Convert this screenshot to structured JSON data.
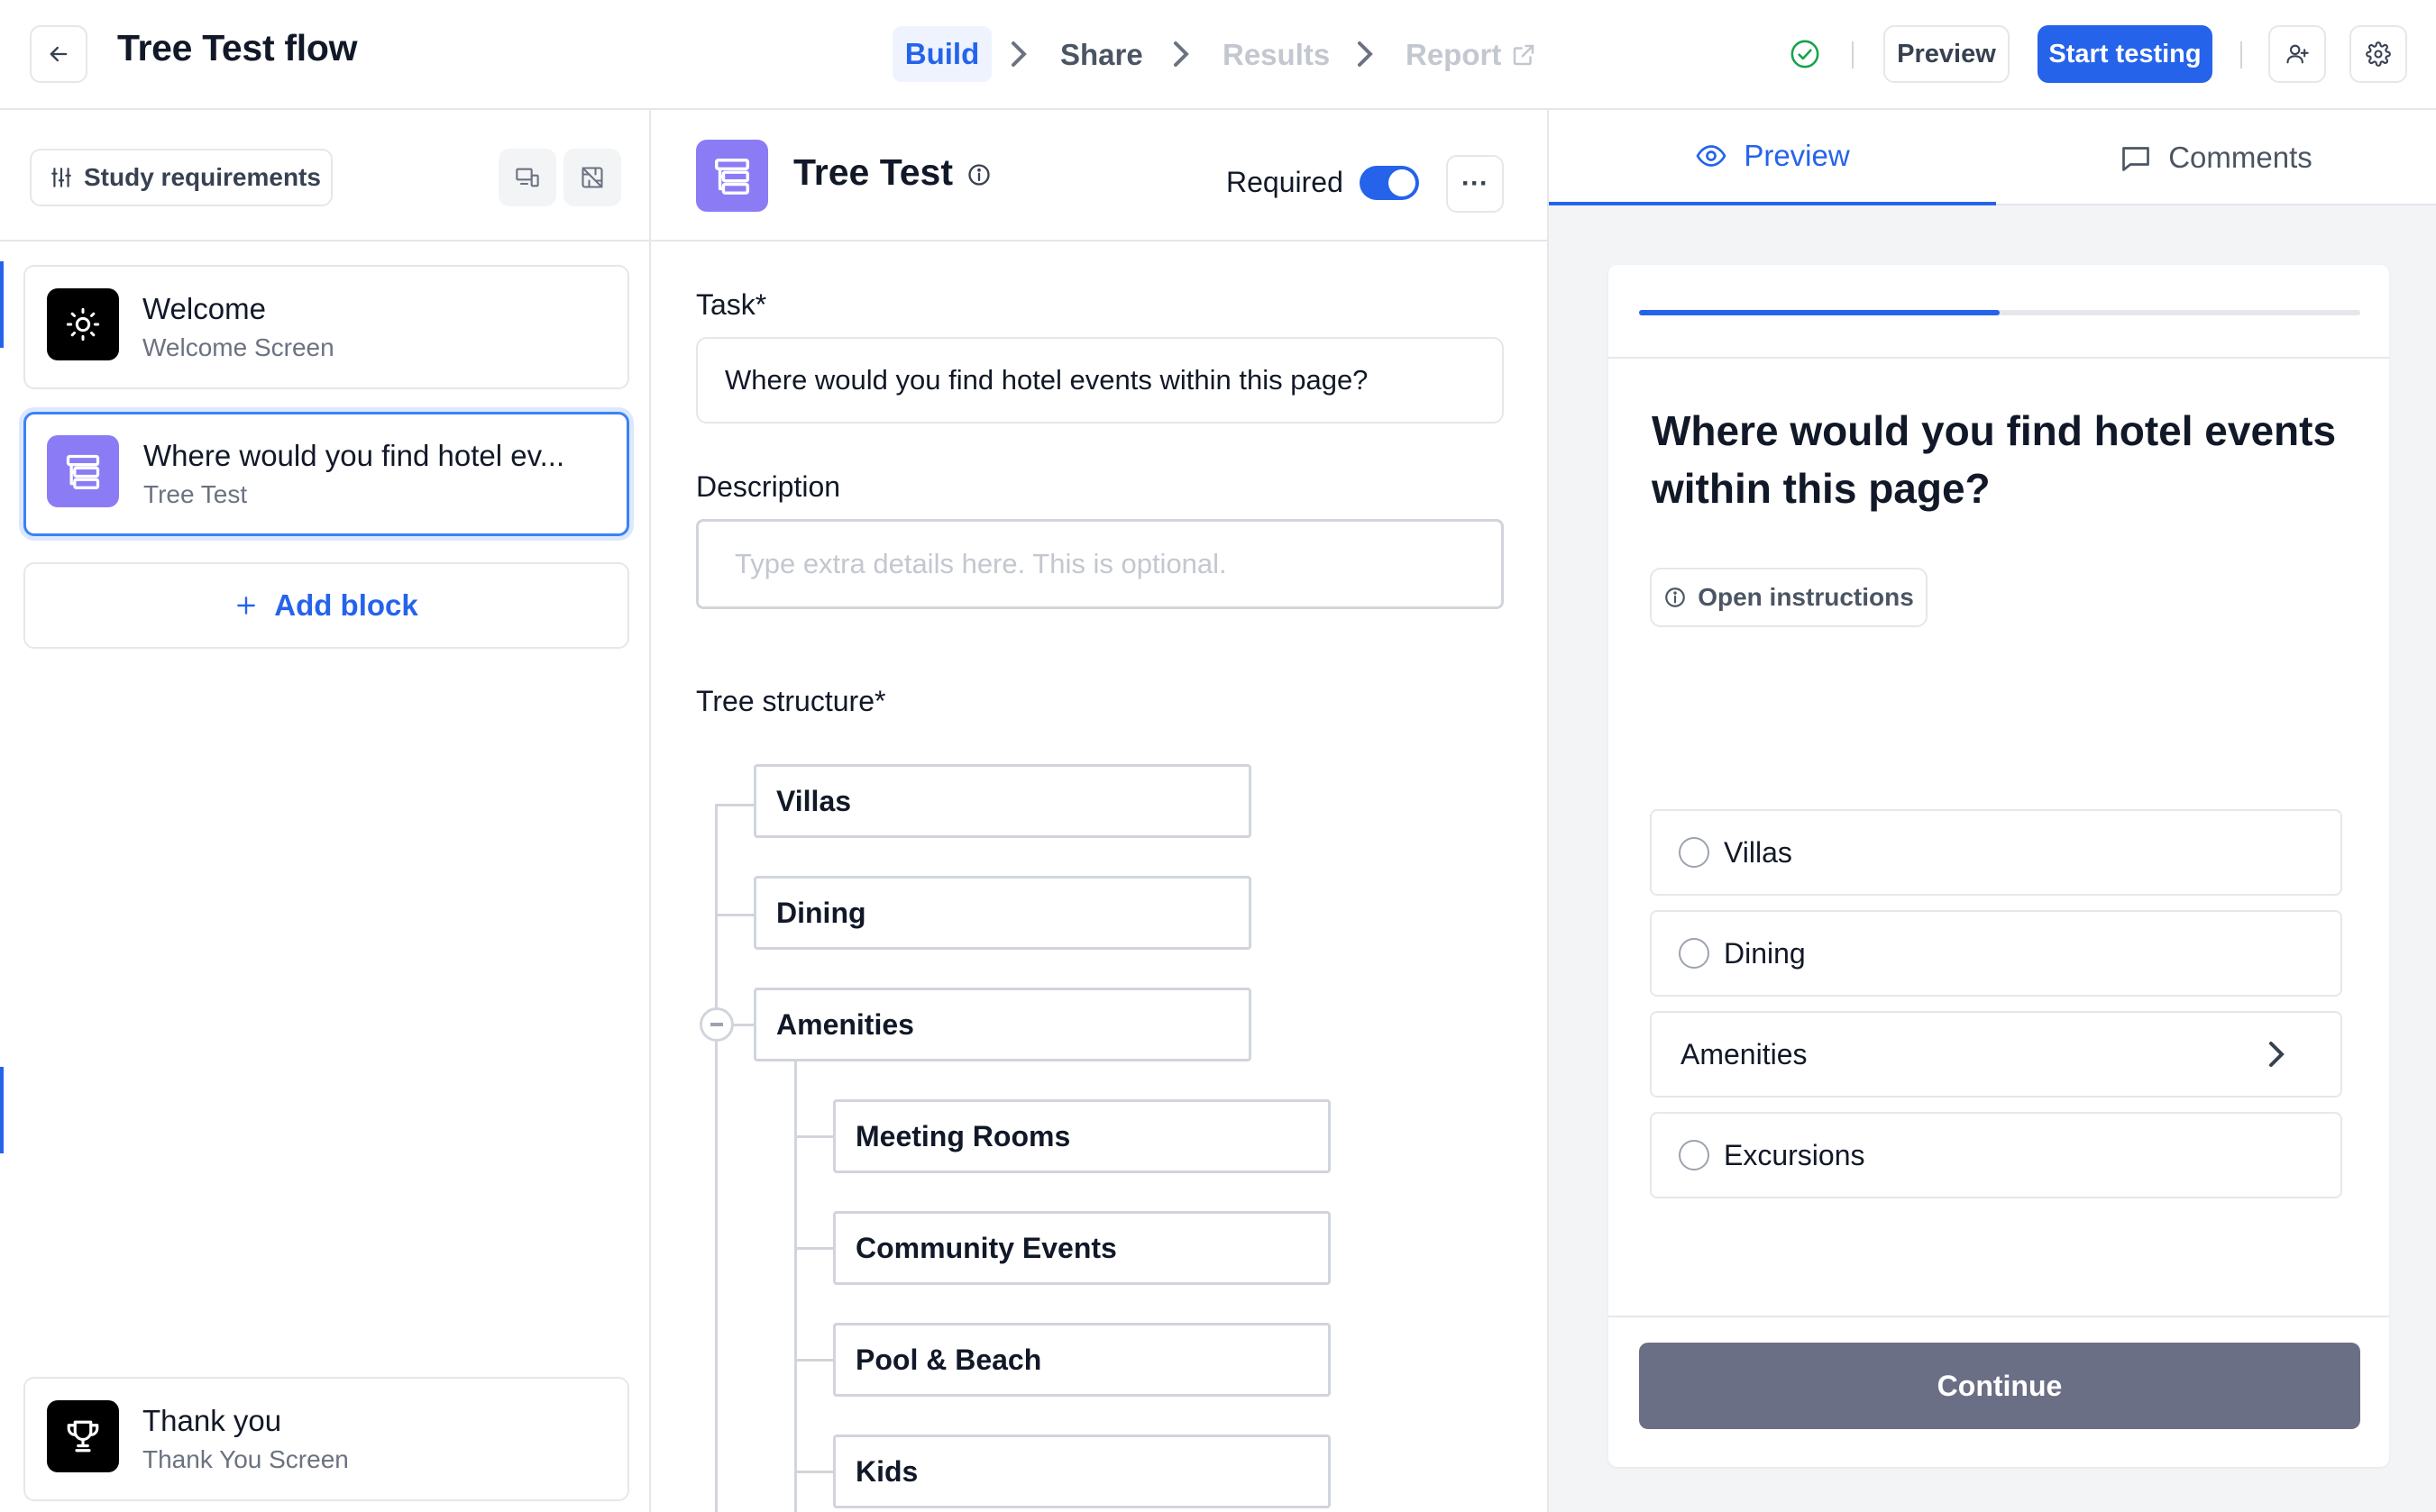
{
  "header": {
    "title": "Tree Test flow",
    "steps": {
      "build": "Build",
      "share": "Share",
      "results": "Results",
      "report": "Report"
    },
    "preview_label": "Preview",
    "start_label": "Start testing",
    "accent_color": "#2563eb"
  },
  "sidebar": {
    "requirements_label": "Study requirements",
    "blocks": [
      {
        "title": "Welcome",
        "subtitle": "Welcome Screen",
        "icon": "sun-icon"
      },
      {
        "title": "Where would you find hotel ev...",
        "subtitle": "Tree Test",
        "icon": "tree-test-icon"
      }
    ],
    "add_block_label": "Add block",
    "end_block": {
      "title": "Thank you",
      "subtitle": "Thank You Screen",
      "icon": "trophy-icon"
    }
  },
  "editor": {
    "title": "Tree Test",
    "required_label": "Required",
    "required_on": true,
    "more_label": "···",
    "task_label": "Task*",
    "task_value": "Where would you find hotel events within this page?",
    "description_label": "Description",
    "description_placeholder": "Type extra details here. This is optional.",
    "tree_label": "Tree structure*",
    "tree": {
      "top_level": [
        "Villas",
        "Dining",
        "Amenities"
      ],
      "amenities_children": [
        "Meeting Rooms",
        "Community Events",
        "Pool & Beach",
        "Kids"
      ]
    }
  },
  "preview_panel": {
    "tabs": {
      "preview": "Preview",
      "comments": "Comments"
    },
    "progress_fraction": 0.5,
    "question": "Where would you find hotel events within this page?",
    "open_instructions_label": "Open instructions",
    "options": [
      "Villas",
      "Dining",
      "Amenities",
      "Excursions"
    ],
    "continue_label": "Continue"
  }
}
